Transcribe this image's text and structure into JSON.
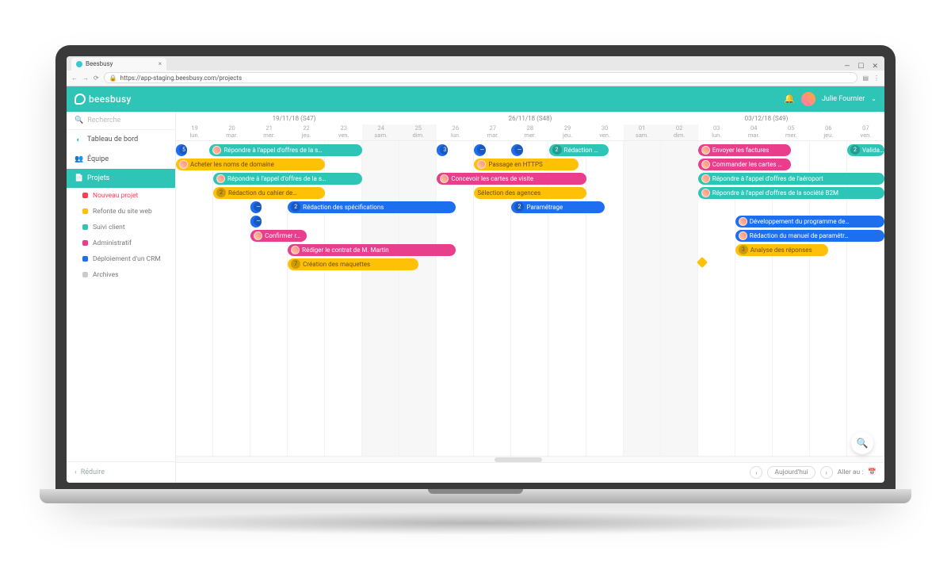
{
  "browser": {
    "tab_title": "Beesbusy",
    "url": "https://app-staging.beesbusy.com/projects"
  },
  "header": {
    "brand": "beesbusy",
    "user_name": "Julie Fournier"
  },
  "sidebar": {
    "search_placeholder": "Recherche",
    "items": [
      {
        "label": "Tableau de bord",
        "icon": "◐",
        "iconColor": "#2ec4b6"
      },
      {
        "label": "Équipe",
        "icon": "👥",
        "iconColor": "#2ec4b6"
      },
      {
        "label": "Projets",
        "icon": "📄",
        "iconColor": "#fff",
        "active": true
      }
    ],
    "subitems": [
      {
        "label": "Nouveau projet",
        "new": true,
        "dotColor": "#ff3e50"
      },
      {
        "label": "Refonte du site web",
        "dotColor": "#ffc107"
      },
      {
        "label": "Suivi client",
        "dotColor": "#2ec4b6"
      },
      {
        "label": "Administratif",
        "dotColor": "#e83e8c"
      },
      {
        "label": "Déploiement d'un CRM",
        "dotColor": "#1e6ef0"
      },
      {
        "label": "Archives",
        "dotColor": "#ccc"
      }
    ],
    "reduce_label": "Réduire"
  },
  "timeline": {
    "weeks": [
      "19/11/18 (S47)",
      "26/11/18 (S48)",
      "03/12/18 (S49)"
    ],
    "days": [
      {
        "n": "19",
        "d": "lun."
      },
      {
        "n": "20",
        "d": "mar."
      },
      {
        "n": "21",
        "d": "mer."
      },
      {
        "n": "22",
        "d": "jeu."
      },
      {
        "n": "23",
        "d": "ven."
      },
      {
        "n": "24",
        "d": "sam.",
        "w": true
      },
      {
        "n": "25",
        "d": "dim.",
        "w": true
      },
      {
        "n": "26",
        "d": "lun."
      },
      {
        "n": "27",
        "d": "mar."
      },
      {
        "n": "28",
        "d": "mer."
      },
      {
        "n": "29",
        "d": "jeu."
      },
      {
        "n": "30",
        "d": "ven."
      },
      {
        "n": "01",
        "d": "sam.",
        "w": true
      },
      {
        "n": "02",
        "d": "dim.",
        "w": true
      },
      {
        "n": "03",
        "d": "lun."
      },
      {
        "n": "04",
        "d": "mar."
      },
      {
        "n": "05",
        "d": "mer."
      },
      {
        "n": "06",
        "d": "jeu."
      },
      {
        "n": "07",
        "d": "ven."
      }
    ]
  },
  "tasks": [
    {
      "row": 0,
      "start": 0,
      "span": 0.3,
      "color": "c-blue",
      "badge": "5"
    },
    {
      "row": 0,
      "start": 0.9,
      "span": 4.1,
      "color": "c-teal",
      "text": "Répondre à l'appel d'offres de la s…",
      "avatar": true
    },
    {
      "row": 0,
      "start": 7,
      "span": 0.3,
      "color": "c-blue",
      "badge": "3"
    },
    {
      "row": 0,
      "start": 8,
      "span": 0.3,
      "color": "c-blue",
      "badge": "—"
    },
    {
      "row": 0,
      "start": 9,
      "span": 0.3,
      "color": "c-blue",
      "badge": "—"
    },
    {
      "row": 0,
      "start": 10,
      "span": 1.6,
      "color": "c-teal",
      "text": "Rédaction …",
      "badge": "2"
    },
    {
      "row": 0,
      "start": 14,
      "span": 2.5,
      "color": "c-pink",
      "text": "Envoyer les factures",
      "avatar": true
    },
    {
      "row": 0,
      "start": 18,
      "span": 1,
      "color": "c-teal",
      "text": "Valida…",
      "badge": "2"
    },
    {
      "row": 1,
      "start": 0,
      "span": 4,
      "color": "c-yellow",
      "text": "Acheter les noms de domaine",
      "avatar": true
    },
    {
      "row": 1,
      "start": 8,
      "span": 2.8,
      "color": "c-yellow",
      "text": "Passage en HTTPS",
      "avatar": true
    },
    {
      "row": 1,
      "start": 14,
      "span": 2.5,
      "color": "c-pink",
      "text": "Commander les cartes …",
      "avatar": true
    },
    {
      "row": 2,
      "start": 1,
      "span": 4,
      "color": "c-teal",
      "text": "Répondre à l'appel d'offres de la s…",
      "avatar": true
    },
    {
      "row": 2,
      "start": 7,
      "span": 4,
      "color": "c-pink",
      "text": "Concevoir les cartes de visite",
      "avatar": true
    },
    {
      "row": 2,
      "start": 14,
      "span": 5,
      "color": "c-teal",
      "text": "Répondre à l'appel d'offres de l'aéroport",
      "avatar": true
    },
    {
      "row": 3,
      "start": 1,
      "span": 3,
      "color": "c-yellow",
      "text": "Rédaction du cahier de…",
      "badge": "2"
    },
    {
      "row": 3,
      "start": 8,
      "span": 3,
      "color": "c-yellow",
      "text": "Sélection des agences"
    },
    {
      "row": 3,
      "start": 14,
      "span": 5,
      "color": "c-teal",
      "text": "Répondre à l'appel d'offres de la société B2M",
      "avatar": true
    },
    {
      "row": 4,
      "start": 2,
      "span": 0.3,
      "color": "c-blue",
      "badge": "—"
    },
    {
      "row": 4,
      "start": 3,
      "span": 4.5,
      "color": "c-blue",
      "text": "Rédaction des spécifications",
      "badge": "2"
    },
    {
      "row": 4,
      "start": 9,
      "span": 2.5,
      "color": "c-blue",
      "text": "Paramétrage",
      "badge": "2"
    },
    {
      "row": 5,
      "start": 2,
      "span": 0.3,
      "color": "c-blue",
      "badge": "—"
    },
    {
      "row": 5,
      "start": 15,
      "span": 4,
      "color": "c-blue",
      "text": "Développement du programme de…",
      "avatar": true
    },
    {
      "row": 6,
      "start": 2,
      "span": 1.5,
      "color": "c-pink",
      "text": "Confirmer r…",
      "avatar": true
    },
    {
      "row": 6,
      "start": 15,
      "span": 4,
      "color": "c-blue",
      "text": "Rédaction du manuel de paramétr…",
      "avatar": true
    },
    {
      "row": 7,
      "start": 3,
      "span": 4.5,
      "color": "c-pink",
      "text": "Rédiger le contrat de M. Martin",
      "avatar": true
    },
    {
      "row": 7,
      "start": 15,
      "span": 2.5,
      "color": "c-yellow",
      "text": "Analyse des réponses",
      "badge": "3"
    },
    {
      "row": 8,
      "start": 3,
      "span": 3.5,
      "color": "c-yellow",
      "text": "Création des maquettes",
      "badge": "7"
    },
    {
      "row": 8,
      "start": 14,
      "span": 0.3,
      "color": "c-yellow",
      "diamond": true
    }
  ],
  "bottom": {
    "today_label": "Aujourd'hui",
    "goto_label": "Aller au :"
  }
}
